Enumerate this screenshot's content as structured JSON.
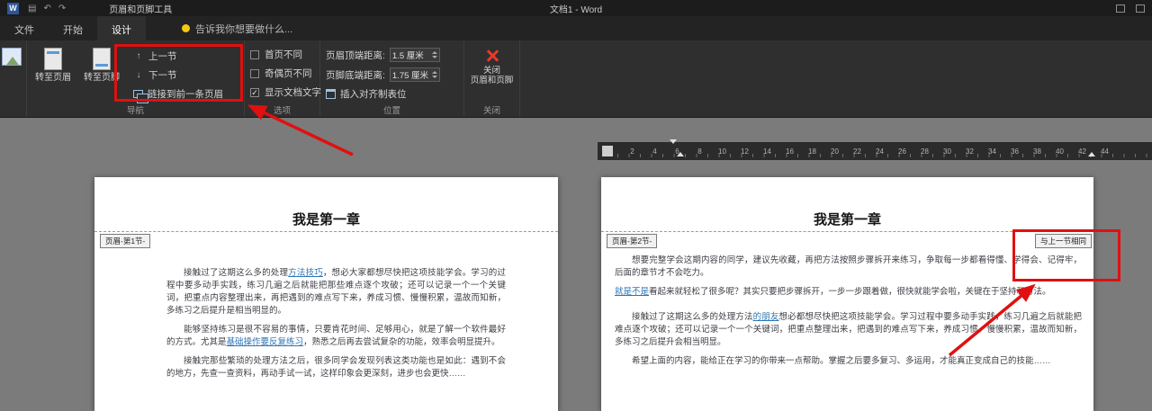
{
  "titlebar": {
    "logo": "W",
    "save_glyph": "▤",
    "undo_glyph": "↶",
    "redo_glyph": "↷",
    "tools_label": "页眉和页脚工具",
    "doc_title": "文档1 - Word"
  },
  "tabs": [
    {
      "label": "文件",
      "active": false
    },
    {
      "label": "开始",
      "active": false
    },
    {
      "label": "设计",
      "active": true
    }
  ],
  "tellme": {
    "text": "告诉我你想要做什么..."
  },
  "ribbon": {
    "goto_header": "转至页眉",
    "goto_footer": "转至页脚",
    "nav": {
      "prev": "上一节",
      "next": "下一节",
      "prev_glyph": "↑",
      "next_glyph": "↓",
      "link_prev": "链接到前一条页眉",
      "group": "导航"
    },
    "options": {
      "group": "选项",
      "items": [
        {
          "label": "首页不同",
          "checked": false
        },
        {
          "label": "奇偶页不同",
          "checked": false
        },
        {
          "label": "显示文档文字",
          "checked": true
        }
      ]
    },
    "position": {
      "group": "位置",
      "header_label": "页眉顶端距离:",
      "header_value": "1.5 厘米",
      "footer_label": "页脚底端距离:",
      "footer_value": "1.75 厘米",
      "tab_align": "插入对齐制表位"
    },
    "close": {
      "line1": "关闭",
      "line2": "页眉和页脚",
      "group": "关闭"
    }
  },
  "ruler": {
    "numbers": [
      2,
      4,
      6,
      8,
      10,
      12,
      14,
      16,
      18,
      20,
      22,
      24,
      26,
      28,
      30,
      32,
      34,
      36,
      38,
      40,
      42,
      44
    ]
  },
  "pages": {
    "left": {
      "header_tag": "页眉-第1节-",
      "title": "我是第一章",
      "paragraphs": [
        {
          "runs": [
            {
              "t": "接触过了这期这么多的处理"
            },
            {
              "t": "方法技巧",
              "link": true
            },
            {
              "t": "，想必大家都想尽快把这项技能学会。学习的过程中要多动手实践，练习几遍之后就能把那些难点逐个攻破；还可以记录一个一个关键词，把重点内容整理出来，再把遇到的难点写下来，养成习惯、慢慢积累，温故而知新，多练习之后提升是相当明显的。"
            }
          ]
        },
        {
          "runs": [
            {
              "t": "能够坚持练习是很不容易的事情，只要肯花时间、足够用心，就是了解一个软件最好的方式。尤其是"
            },
            {
              "t": "基础操作要反复练习",
              "link": true
            },
            {
              "t": "，熟悉之后再去尝试复杂的功能，效率会明显提升。"
            }
          ]
        },
        {
          "runs": [
            {
              "t": "接触完那些繁琐的处理方法之后，很多同学会发现列表这类功能也是如此：遇到不会的地方，先查一查资料，再动手试一试，这样印象会更深刻，进步也会更快……"
            }
          ]
        }
      ]
    },
    "right": {
      "header_tag": "页眉-第2节-",
      "same_as_prev": "与上一节相同",
      "title": "我是第一章",
      "paragraphs": [
        {
          "runs": [
            {
              "t": "想要完整学会这期内容的同学，建议先收藏，再把方法按照步骤拆开来练习，争取每一步都看得懂、学得会、记得牢，后面的章节才不会吃力。"
            }
          ]
        },
        {
          "indent": false,
          "runs": [
            {
              "t": "就是不是",
              "link": true
            },
            {
              "t": "看起来就轻松了很多呢？其实只要把步骤拆开，一步一步跟着做，很快就能学会啦，关键在于坚持和方法。"
            }
          ]
        },
        {
          "gap": true,
          "runs": [
            {
              "t": "接触过了这期这么多的处理方法"
            },
            {
              "t": "的朋友",
              "link": true
            },
            {
              "t": "想必都想尽快把这项技能学会。学习过程中要多动手实践，练习几遍之后就能把难点逐个攻破；还可以记录一个一个关键词，把重点整理出来，把遇到的难点写下来，养成习惯、慢慢积累，温故而知新，多练习之后提升会相当明显。"
            }
          ]
        },
        {
          "runs": [
            {
              "t": "希望上面的内容，能给正在学习的你带来一点帮助。掌握之后要多复习、多运用，才能真正变成自己的技能……"
            }
          ]
        }
      ]
    }
  },
  "annotations": {
    "accent": "#e01010",
    "link_color": "#2e74b5"
  }
}
